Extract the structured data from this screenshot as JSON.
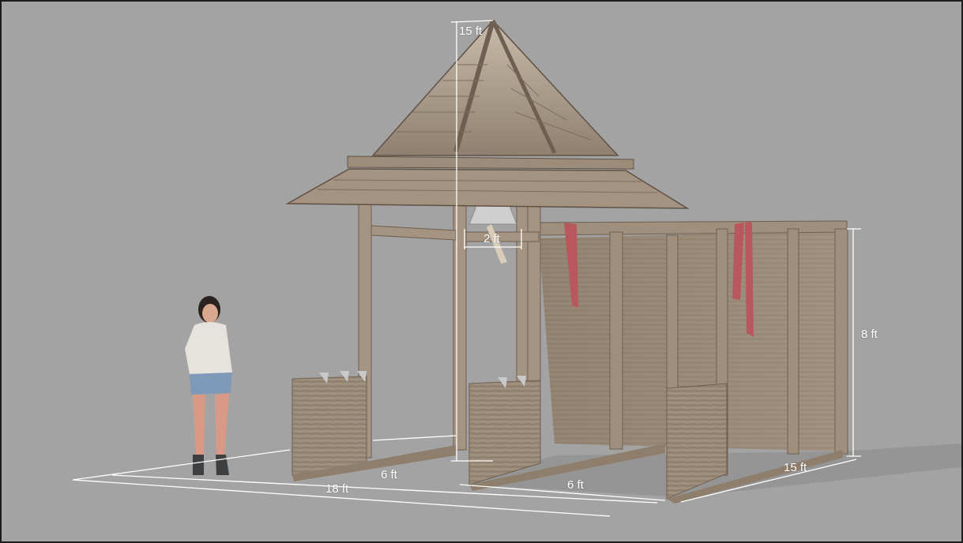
{
  "dimensions": {
    "roof_height": "15 ft",
    "bell_width": "2 ft",
    "wall_height": "8 ft",
    "front_left": "6 ft",
    "front_right": "6 ft",
    "total_length": "18 ft",
    "depth": "15 ft"
  },
  "colors": {
    "background": "#a3a3a3",
    "wood": "#9a8a78",
    "wood_dark": "#6e5f50",
    "dimension_line": "#ffffff",
    "ribbon": "#b8585c"
  }
}
